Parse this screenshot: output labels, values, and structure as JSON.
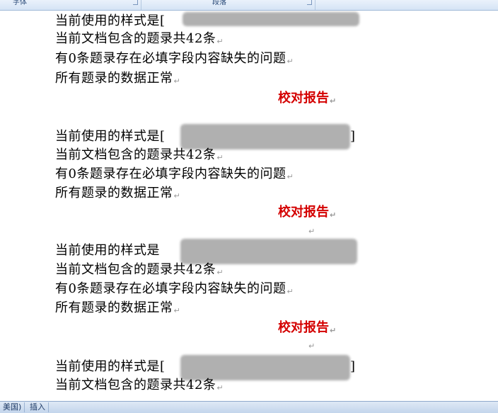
{
  "ribbon": {
    "font_group": "字体",
    "paragraph_group": "段落"
  },
  "document": {
    "blocks": [
      {
        "style_label": "当前使用的样式是",
        "style_bracket_open": "[",
        "style_bracket_close": "]",
        "count_line": "当前文档包含的题录共42条",
        "missing_line": "有0条题录存在必填字段内容缺失的问题",
        "ok_line": "所有题录的数据正常",
        "report_title": "校对报告"
      },
      {
        "style_label": "当前使用的样式是",
        "style_bracket_open": "[",
        "style_bracket_close": "]",
        "count_line": "当前文档包含的题录共42条",
        "missing_line": "有0条题录存在必填字段内容缺失的问题",
        "ok_line": "所有题录的数据正常",
        "report_title": "校对报告"
      },
      {
        "style_label": "当前使用的样式是",
        "count_line": "当前文档包含的题录共42条",
        "missing_line": "有0条题录存在必填字段内容缺失的问题",
        "ok_line": "所有题录的数据正常",
        "report_title": "校对报告"
      },
      {
        "style_label": "当前使用的样式是",
        "style_bracket_open": "[",
        "style_bracket_close": "]",
        "count_line": "当前文档包含的题录共42条"
      }
    ],
    "paragraph_mark": "↵"
  },
  "statusbar": {
    "language": "美国)",
    "insert_mode": "插入"
  }
}
